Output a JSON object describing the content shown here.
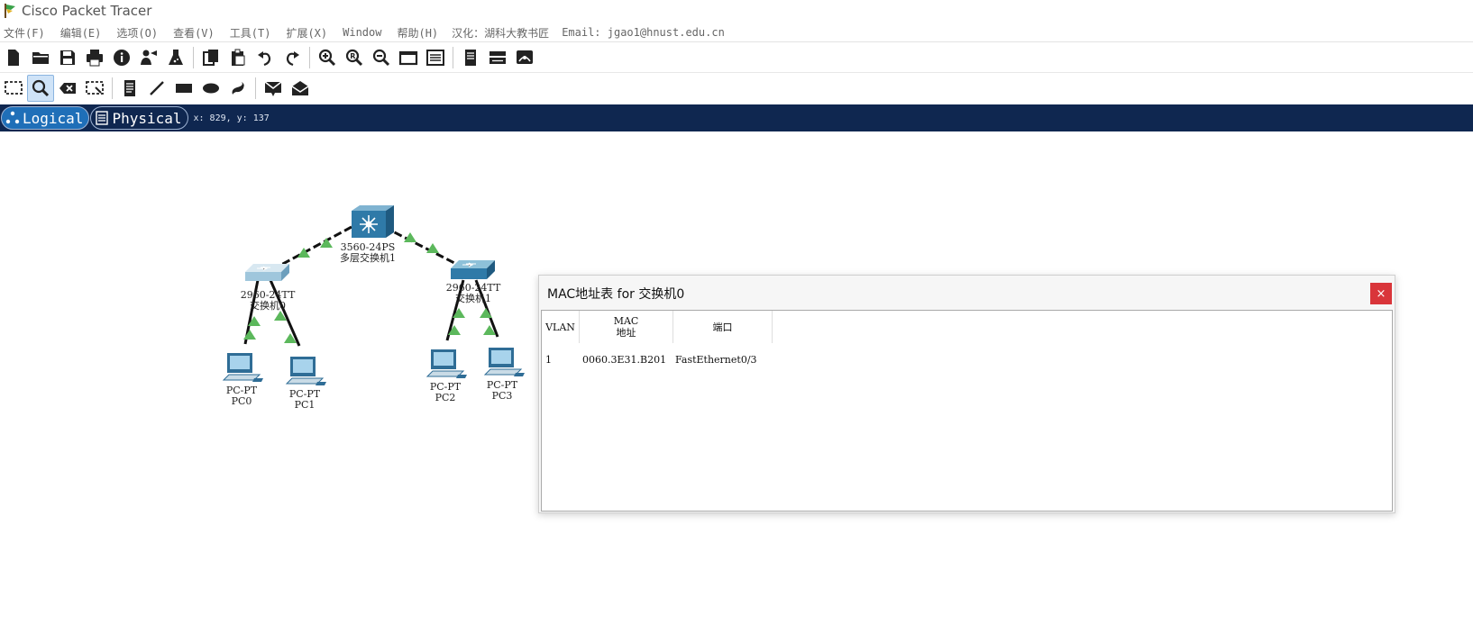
{
  "app": {
    "title": "Cisco Packet Tracer",
    "icon": "packet-tracer-icon"
  },
  "menu": {
    "items": [
      "文件(F)",
      "编辑(E)",
      "选项(O)",
      "查看(V)",
      "工具(T)",
      "扩展(X)",
      "Window",
      "帮助(H)"
    ],
    "credit": "汉化：湖科大教书匠",
    "email": "Email: jgao1@hnust.edu.cn"
  },
  "toolbar": {
    "main_icons": [
      "new-file",
      "open-folder",
      "save",
      "print",
      "info",
      "activity-wizard",
      "lab-flask",
      "copy",
      "paste",
      "undo",
      "redo",
      "zoom-in",
      "zoom-reset",
      "zoom-out",
      "window",
      "list-view",
      "notes",
      "device-template",
      "custom-device"
    ],
    "draw_icons": [
      "select",
      "inspect",
      "delete",
      "resize",
      "note",
      "line",
      "rectangle",
      "ellipse",
      "freeform",
      "simple-pdu",
      "complex-pdu"
    ],
    "active_tool": "inspect"
  },
  "modebar": {
    "logical_label": "Logical",
    "physical_label": "Physical",
    "coords": "x: 829, y: 137",
    "active_mode": "logical"
  },
  "topology": {
    "devices": [
      {
        "id": "mls1",
        "model": "3560-24PS",
        "name": "多层交换机1",
        "type": "multilayer-switch"
      },
      {
        "id": "sw0",
        "model": "2960-24TT",
        "name": "交换机0",
        "type": "switch"
      },
      {
        "id": "sw1",
        "model": "2960-24TT",
        "name": "交换机1",
        "type": "switch"
      },
      {
        "id": "pc0",
        "model": "PC-PT",
        "name": "PC0",
        "type": "pc"
      },
      {
        "id": "pc1",
        "model": "PC-PT",
        "name": "PC1",
        "type": "pc"
      },
      {
        "id": "pc2",
        "model": "PC-PT",
        "name": "PC2",
        "type": "pc"
      },
      {
        "id": "pc3",
        "model": "PC-PT",
        "name": "PC3",
        "type": "pc"
      }
    ],
    "link_status_color": "#5cb85c"
  },
  "mac_dialog": {
    "title": "MAC地址表 for 交换机0",
    "close": "×",
    "headers": {
      "vlan": "VLAN",
      "mac": "MAC\n地址",
      "port": "端口"
    },
    "rows": [
      {
        "vlan": "1",
        "mac": "0060.3E31.B201",
        "port": "FastEthernet0/3"
      }
    ]
  },
  "colors": {
    "mode_bar": "#0f2750",
    "logical_active": "#1f6fb8",
    "close_button": "#d9353a",
    "device_blue": "#2f6d96"
  }
}
